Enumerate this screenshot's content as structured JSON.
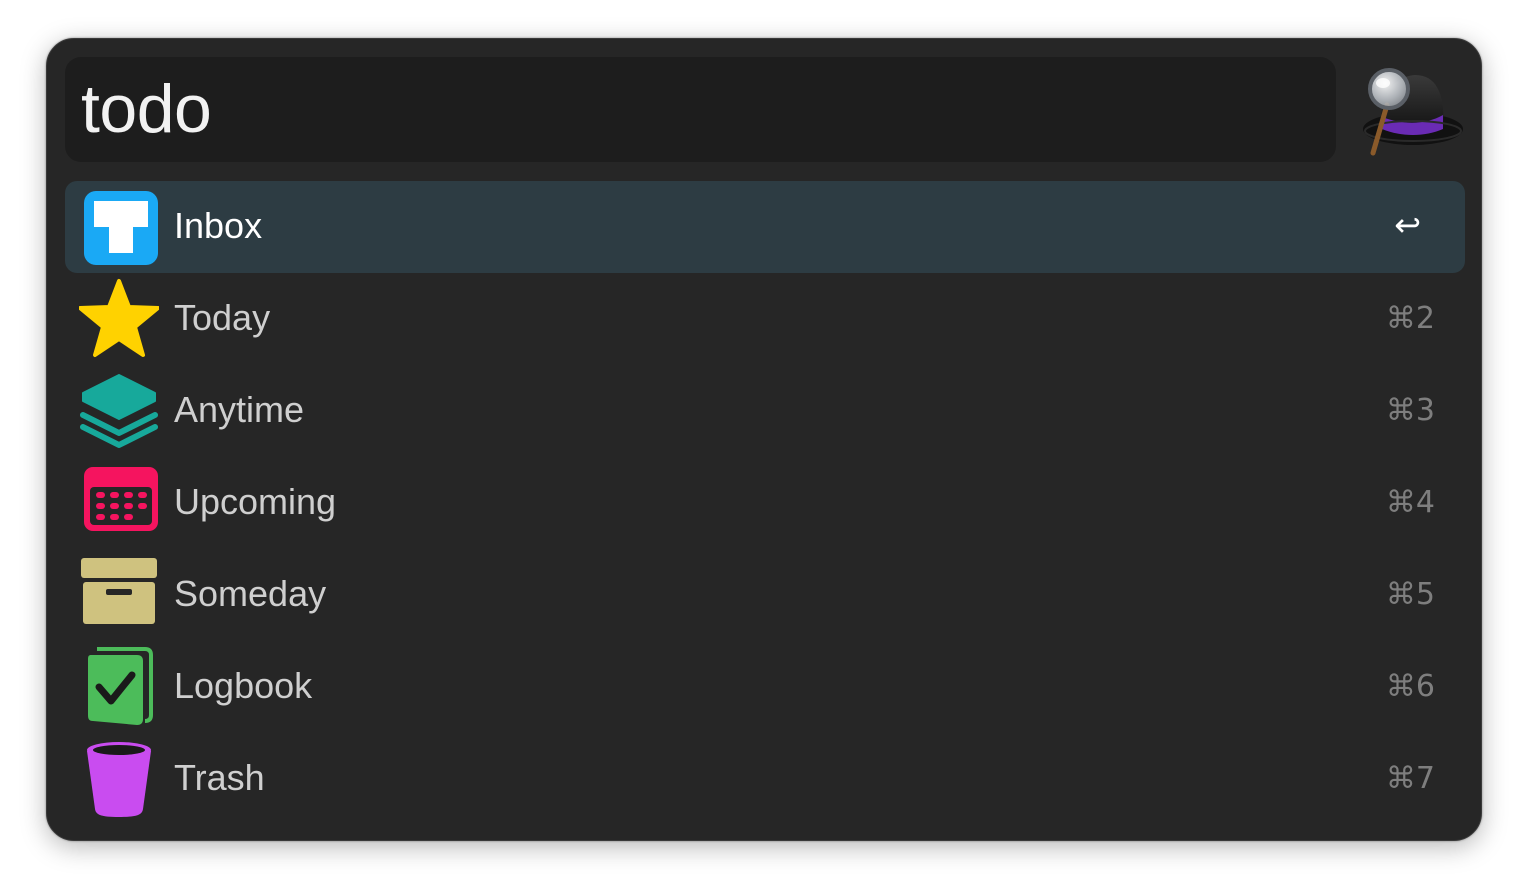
{
  "search": {
    "query": "todo"
  },
  "results": [
    {
      "label": "Inbox",
      "shortcut": "↩",
      "icon": "inbox-icon",
      "color": "#1aa9f5",
      "selected": true
    },
    {
      "label": "Today",
      "shortcut": "⌘2",
      "icon": "star-icon",
      "color": "#ffd200"
    },
    {
      "label": "Anytime",
      "shortcut": "⌘3",
      "icon": "layers-icon",
      "color": "#17a99b"
    },
    {
      "label": "Upcoming",
      "shortcut": "⌘4",
      "icon": "calendar-icon",
      "color": "#f5145f"
    },
    {
      "label": "Someday",
      "shortcut": "⌘5",
      "icon": "archive-box-icon",
      "color": "#cfc27f"
    },
    {
      "label": "Logbook",
      "shortcut": "⌘6",
      "icon": "logbook-check-icon",
      "color": "#4cbc5a"
    },
    {
      "label": "Trash",
      "shortcut": "⌘7",
      "icon": "trash-icon",
      "color": "#c94cf0"
    }
  ],
  "colors": {
    "window_bg": "#262626",
    "search_bg": "#1d1d1d",
    "selection_bg": "#2d3c43"
  }
}
